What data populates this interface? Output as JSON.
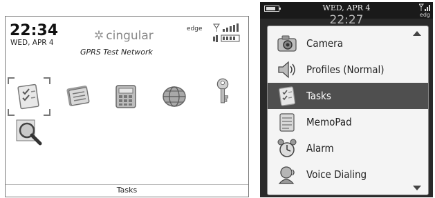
{
  "left_screen": {
    "time": "22:34",
    "date": "WED, APR 4",
    "carrier": "cingular",
    "network": "GPRS Test Network",
    "connection": "edge",
    "selected_label": "Tasks",
    "icons": [
      "tasks-icon",
      "memopad-icon",
      "calculator-icon",
      "browser-icon",
      "password-keeper-icon",
      "search-icon"
    ]
  },
  "right_screen": {
    "date": "WED, APR 4",
    "time": "22:27",
    "connection": "edg",
    "menu_items": [
      {
        "label": "Camera",
        "icon": "camera-icon"
      },
      {
        "label": "Profiles (Normal)",
        "icon": "speaker-icon"
      },
      {
        "label": "Tasks",
        "icon": "tasks-icon",
        "selected": true
      },
      {
        "label": "MemoPad",
        "icon": "memopad-icon"
      },
      {
        "label": "Alarm",
        "icon": "alarm-clock-icon"
      },
      {
        "label": "Voice Dialing",
        "icon": "voice-dialing-icon"
      }
    ]
  }
}
